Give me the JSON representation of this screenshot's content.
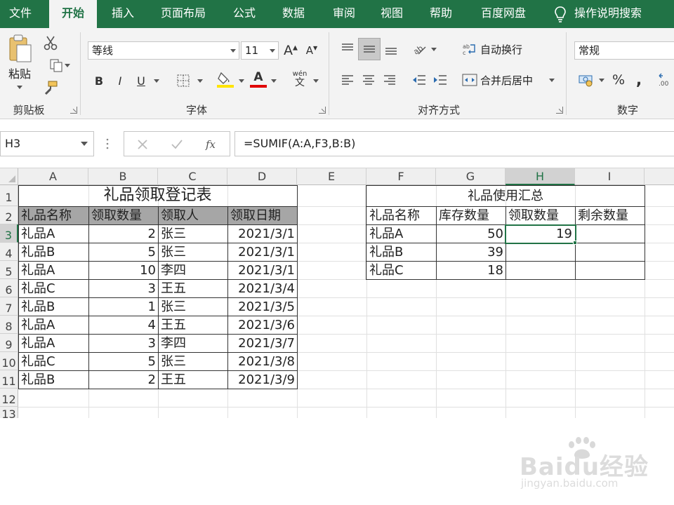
{
  "menu": {
    "tabs": [
      "文件",
      "开始",
      "插入",
      "页面布局",
      "公式",
      "数据",
      "审阅",
      "视图",
      "帮助",
      "百度网盘"
    ],
    "active_tab": "开始",
    "tell_me": "操作说明搜索"
  },
  "ribbon": {
    "clipboard": {
      "paste": "粘贴",
      "label": "剪贴板"
    },
    "font": {
      "name": "等线",
      "size": "11",
      "bold": "B",
      "italic": "I",
      "underline": "U",
      "font_color": "A",
      "pinyin": "wén",
      "label": "字体"
    },
    "alignment": {
      "wrap_text": "自动换行",
      "merge_center": "合并后居中",
      "label": "对齐方式"
    },
    "number": {
      "format": "常规",
      "percent": "%",
      "comma": ",",
      "label": "数字"
    }
  },
  "formula_bar": {
    "name_box": "H3",
    "formula": "=SUMIF(A:A,F3,B:B)"
  },
  "sheet": {
    "columns": [
      "A",
      "B",
      "C",
      "D",
      "E",
      "F",
      "G",
      "H",
      "I"
    ],
    "selected_column": "H",
    "rows": [
      "1",
      "2",
      "3",
      "4",
      "5",
      "6",
      "7",
      "8",
      "9",
      "10",
      "11",
      "12",
      "13"
    ],
    "selected_row": "3",
    "selected_cell": "H3",
    "log_table": {
      "title": "礼品领取登记表",
      "headers": [
        "礼品名称",
        "领取数量",
        "领取人",
        "领取日期"
      ],
      "rows": [
        [
          "礼品A",
          "2",
          "张三",
          "2021/3/1"
        ],
        [
          "礼品B",
          "5",
          "张三",
          "2021/3/1"
        ],
        [
          "礼品A",
          "10",
          "李四",
          "2021/3/1"
        ],
        [
          "礼品C",
          "3",
          "王五",
          "2021/3/4"
        ],
        [
          "礼品B",
          "1",
          "张三",
          "2021/3/5"
        ],
        [
          "礼品A",
          "4",
          "王五",
          "2021/3/6"
        ],
        [
          "礼品A",
          "3",
          "李四",
          "2021/3/7"
        ],
        [
          "礼品C",
          "5",
          "张三",
          "2021/3/8"
        ],
        [
          "礼品B",
          "2",
          "王五",
          "2021/3/9"
        ]
      ]
    },
    "summary_table": {
      "title": "礼品使用汇总",
      "headers": [
        "礼品名称",
        "库存数量",
        "领取数量",
        "剩余数量"
      ],
      "rows": [
        [
          "礼品A",
          "50",
          "19",
          ""
        ],
        [
          "礼品B",
          "39",
          "",
          ""
        ],
        [
          "礼品C",
          "18",
          "",
          ""
        ]
      ]
    }
  },
  "watermark": {
    "brand": "Baidu经验",
    "url": "jingyan.baidu.com"
  },
  "colors": {
    "excel_green": "#217346",
    "header_fill": "#a6a6a6",
    "selection": "#217346"
  }
}
